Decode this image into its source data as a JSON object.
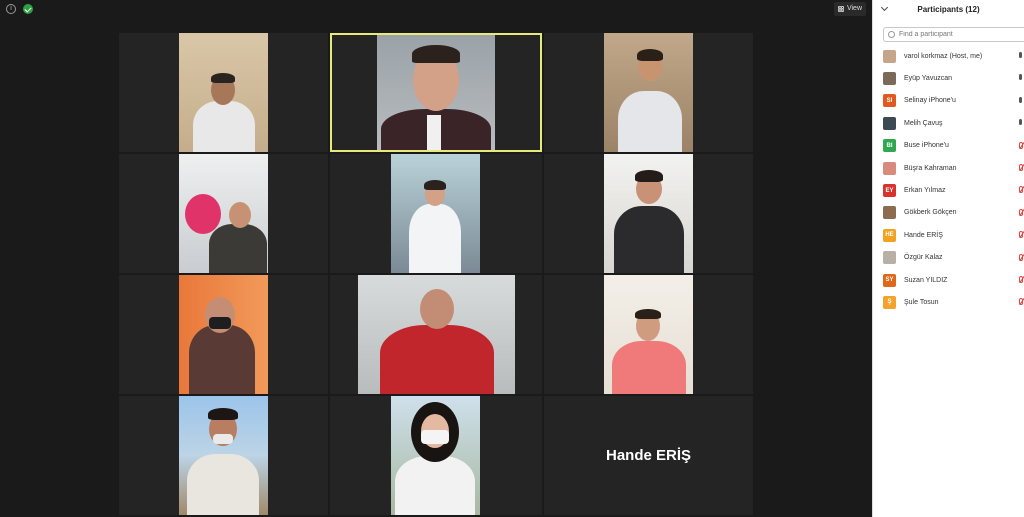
{
  "toolbar": {
    "view_label": "View"
  },
  "active_speaker_name": "Hande ERİŞ",
  "panel": {
    "title": "Participants (12)",
    "search_placeholder": "Find a participant",
    "participants": [
      {
        "name": "varol korkmaz (Host, me)",
        "initials": "",
        "avatar_color": "#c7a58a",
        "mic": "on"
      },
      {
        "name": "Eyüp Yavuzcan",
        "initials": "",
        "avatar_color": "#7b6a58",
        "mic": "on"
      },
      {
        "name": "Selinay iPhone'u",
        "initials": "SI",
        "avatar_color": "#e05a1e",
        "mic": "on"
      },
      {
        "name": "Melih Çavuş",
        "initials": "",
        "avatar_color": "#3c4a52",
        "mic": "on"
      },
      {
        "name": "Buse iPhone'u",
        "initials": "BI",
        "avatar_color": "#2fa84f",
        "mic": "muted"
      },
      {
        "name": "Büşra Kahraman",
        "initials": "",
        "avatar_color": "#d98b7b",
        "mic": "muted"
      },
      {
        "name": "Erkan Yılmaz",
        "initials": "EY",
        "avatar_color": "#d8332f",
        "mic": "muted"
      },
      {
        "name": "Gökberk Gökçen",
        "initials": "",
        "avatar_color": "#8d6b4f",
        "mic": "muted"
      },
      {
        "name": "Hande ERİŞ",
        "initials": "HE",
        "avatar_color": "#f0a220",
        "mic": "muted"
      },
      {
        "name": "Özgür Kalaz",
        "initials": "",
        "avatar_color": "#b8b0a6",
        "mic": "muted"
      },
      {
        "name": "Suzan YILDIZ",
        "initials": "SY",
        "avatar_color": "#e0681a",
        "mic": "muted"
      },
      {
        "name": "Şule Tosun",
        "initials": "Ş",
        "avatar_color": "#f3a32b",
        "mic": "muted"
      }
    ]
  }
}
